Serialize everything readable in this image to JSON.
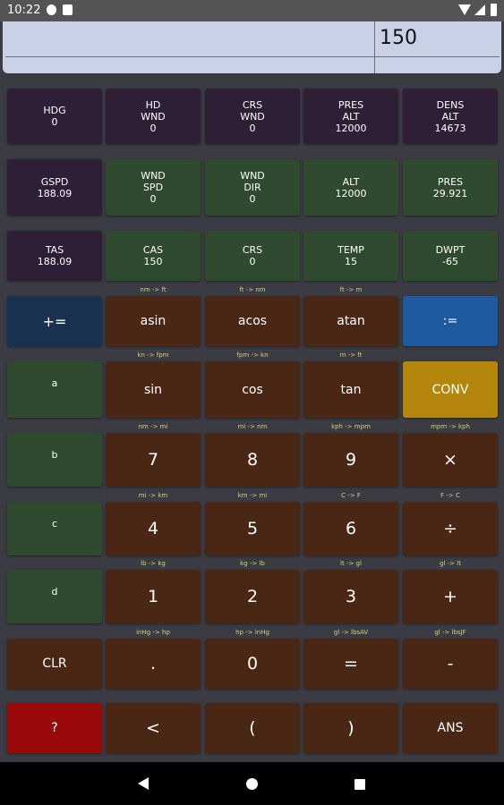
{
  "status": {
    "time": "10:22"
  },
  "display": {
    "value": "150"
  },
  "row1": {
    "hdg": "HDG",
    "hdg_v": "0",
    "hdwnd1": "HD",
    "hdwnd2": "WND",
    "hdwnd_v": "0",
    "crswnd1": "CRS",
    "crswnd2": "WND",
    "crswnd_v": "0",
    "presalt1": "PRES",
    "presalt2": "ALT",
    "presalt_v": "12000",
    "densalt1": "DENS",
    "densalt2": "ALT",
    "densalt_v": "14673"
  },
  "row2": {
    "gspd": "GSPD",
    "gspd_v": "188.09",
    "wndspd1": "WND",
    "wndspd2": "SPD",
    "wndspd_v": "0",
    "wnddir1": "WND",
    "wnddir2": "DIR",
    "wnddir_v": "0",
    "alt": "ALT",
    "alt_v": "12000",
    "pres": "PRES",
    "pres_v": "29.921"
  },
  "row3": {
    "tas": "TAS",
    "tas_v": "188.09",
    "cas": "CAS",
    "cas_v": "150",
    "crs": "CRS",
    "crs_v": "0",
    "temp": "TEMP",
    "temp_v": "15",
    "dwpt": "DWPT",
    "dwpt_v": "-65"
  },
  "hints": {
    "r4": [
      "nm -> ft",
      "ft -> nm",
      "ft -> m"
    ],
    "r5": [
      "kn -> fpm",
      "fpm -> kn",
      "m -> ft"
    ],
    "r6": [
      "nm -> mi",
      "mi -> nm",
      "kph -> mpm",
      "mpm -> kph"
    ],
    "r7": [
      "mi -> km",
      "km -> mi",
      "C -> F",
      "F -> C"
    ],
    "r8": [
      "lb -> kg",
      "kg -> lb",
      "lt -> gl",
      "gl -> lt"
    ],
    "r9": [
      "inHg -> hp",
      "hp -> inHg",
      "gl -> lbsAV",
      "gl -> lbsJF"
    ]
  },
  "keys": {
    "plus_assign": "+=",
    "asin": "asin",
    "acos": "acos",
    "atan": "atan",
    "assign": ":=",
    "a": "a",
    "sin": "sin",
    "cos": "cos",
    "tan": "tan",
    "conv": "CONV",
    "b": "b",
    "k7": "7",
    "k8": "8",
    "k9": "9",
    "mul": "×",
    "c": "c",
    "k4": "4",
    "k5": "5",
    "k6": "6",
    "div": "÷",
    "d": "d",
    "k1": "1",
    "k2": "2",
    "k3": "3",
    "add": "+",
    "clr": "CLR",
    "dot": ".",
    "k0": "0",
    "eq": "=",
    "sub": "-",
    "help": "?",
    "back": "<",
    "lparen": "(",
    "rparen": ")",
    "ans": "ANS"
  },
  "colors": {
    "purple": "#2f1f36",
    "green": "#2f4a2e",
    "brown": "#4a2614",
    "blue": "#1e5aa0",
    "gold": "#b5860c",
    "red": "#9b0a0a"
  }
}
